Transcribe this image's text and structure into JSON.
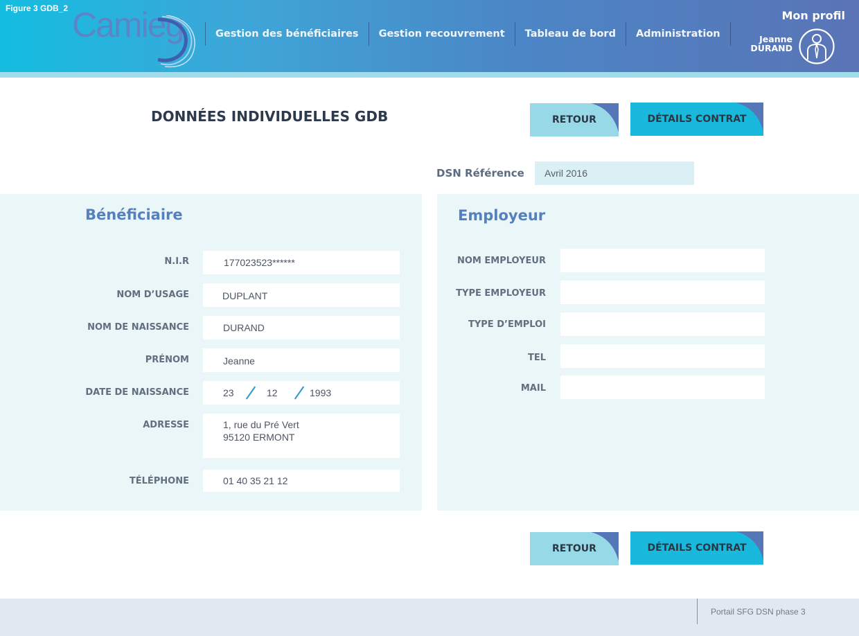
{
  "figure_label": "Figure 3 GDB_2",
  "logo_text": "Camieg",
  "nav": {
    "items": [
      "Gestion des bénéficiaires",
      "Gestion recouvrement",
      "Tableau de bord",
      "Administration"
    ]
  },
  "profile": {
    "label": "Mon profil",
    "first_name": "Jeanne",
    "last_name": "DURAND"
  },
  "page_title": "DONNÉES INDIVIDUELLES GDB",
  "buttons": {
    "retour": "RETOUR",
    "details": "DÉTAILS CONTRAT"
  },
  "dsn": {
    "label": "DSN Référence",
    "value": "Avril 2016"
  },
  "beneficiaire": {
    "title": "Bénéficiaire",
    "nir_label": "N.I.R",
    "nir": "177023523******",
    "nom_usage_label": "NOM D’USAGE",
    "nom_usage": "DUPLANT",
    "nom_naissance_label": "NOM DE NAISSANCE",
    "nom_naissance": "DURAND",
    "prenom_label": "PRÉNOM",
    "prenom": "Jeanne",
    "date_label": "DATE DE NAISSANCE",
    "date_day": "23",
    "date_month": "12",
    "date_year": "1993",
    "adresse_label": "ADRESSE",
    "adresse_line1": "1, rue du Pré Vert",
    "adresse_line2": "95120 ERMONT",
    "telephone_label": "TÉLÉPHONE",
    "telephone": "01 40 35 21 12"
  },
  "employeur": {
    "title": "Employeur",
    "nom_label": "NOM EMPLOYEUR",
    "type_label": "TYPE EMPLOYEUR",
    "emploi_label": "TYPE D’EMPLOI",
    "tel_label": "TEL",
    "mail_label": "MAIL"
  },
  "footer": {
    "text": "Portail SFG DSN phase 3"
  },
  "colors": {
    "header_start": "#14bde0",
    "header_end": "#5a74b6",
    "panel_bg": "#eaf6f8",
    "button_light": "#98d9e8",
    "button_dark": "#18b9dc",
    "accent_title": "#5580bf",
    "footer_bg": "#e2e8f2"
  },
  "icons": {
    "logo": "camieg-logo",
    "avatar": "user-avatar-icon",
    "button_corner": "corner-tab-icon",
    "date_separator": "slash-separator"
  }
}
